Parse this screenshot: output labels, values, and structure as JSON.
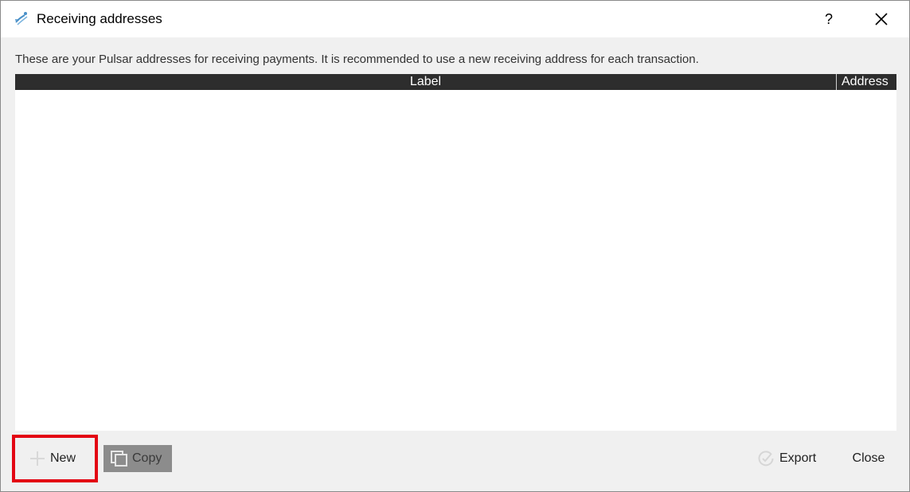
{
  "window": {
    "title": "Receiving addresses",
    "help_label": "?",
    "icons": {
      "app": "pulsar-logo-icon",
      "close": "close-icon"
    }
  },
  "description": "These are your Pulsar addresses for receiving payments. It is recommended to use a new receiving address for each transaction.",
  "table": {
    "columns": [
      "Label",
      "Address"
    ],
    "rows": []
  },
  "buttons": {
    "new_label": "New",
    "copy_label": "Copy",
    "export_label": "Export",
    "close_label": "Close"
  },
  "colors": {
    "highlight": "#e30613",
    "header_bg": "#2d2d2d",
    "dialog_bg": "#f0f0f0"
  }
}
